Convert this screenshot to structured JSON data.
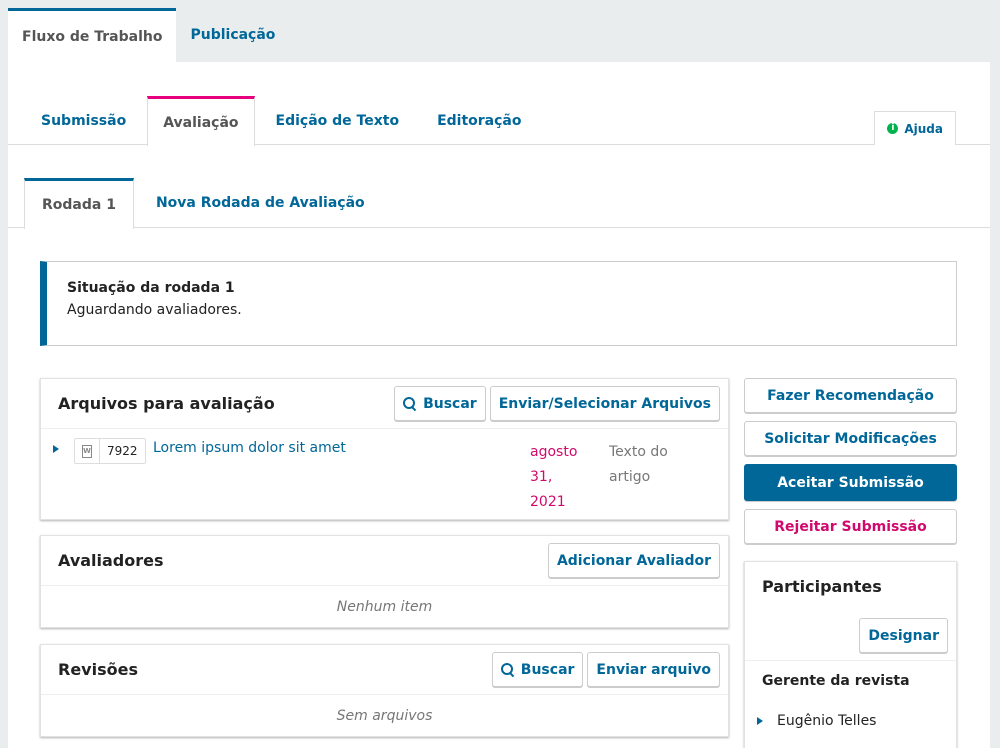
{
  "top_tabs": {
    "workflow": "Fluxo de Trabalho",
    "publication": "Publicação"
  },
  "stage_tabs": {
    "submission": "Submissão",
    "review": "Avaliação",
    "copyediting": "Edição de Texto",
    "production": "Editoração"
  },
  "help": {
    "label": "Ajuda",
    "icon": "info-icon"
  },
  "round_tabs": {
    "round1": "Rodada 1",
    "new_round": "Nova Rodada de Avaliação"
  },
  "round_status": {
    "title": "Situação da rodada 1",
    "text": "Aguardando avaliadores."
  },
  "review_files": {
    "title": "Arquivos para avaliação",
    "search_label": "Buscar",
    "upload_label": "Enviar/Selecionar Arquivos",
    "files": [
      {
        "id": "7922",
        "name": "Lorem ipsum dolor sit amet",
        "date_lines": [
          "agosto",
          "31,",
          "2021"
        ],
        "genre_lines": [
          "Texto do",
          "artigo"
        ],
        "icon": "word-document-icon"
      }
    ]
  },
  "reviewers": {
    "title": "Avaliadores",
    "add_label": "Adicionar Avaliador",
    "empty": "Nenhum item"
  },
  "revisions": {
    "title": "Revisões",
    "search_label": "Buscar",
    "upload_label": "Enviar arquivo",
    "empty": "Sem arquivos"
  },
  "decisions": {
    "recommend": "Fazer Recomendação",
    "request_revisions": "Solicitar Modificações",
    "accept": "Aceitar Submissão",
    "decline": "Rejeitar Submissão"
  },
  "participants": {
    "title": "Participantes",
    "assign_label": "Designar",
    "groups": [
      {
        "name": "Gerente da revista",
        "members": [
          "Eugênio Telles"
        ]
      }
    ]
  },
  "colors": {
    "accent": "#006798",
    "highlight": "#e6007e",
    "date": "#d00a6c",
    "help_icon": "#00b24e",
    "background": "#eaedee"
  }
}
